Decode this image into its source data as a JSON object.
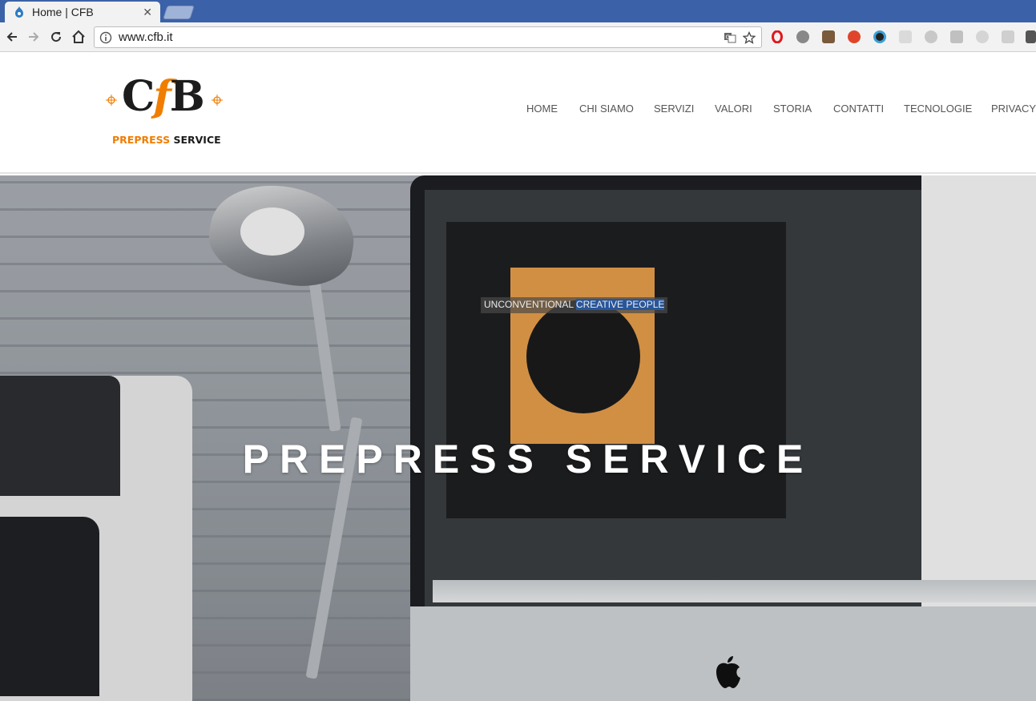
{
  "browser": {
    "tab_title": "Home | CFB",
    "url": "www.cfb.it"
  },
  "site": {
    "logo_mark": "CfB",
    "logo_sub_orange": "PREPRESS",
    "logo_sub_dark": "SERVICE",
    "nav": [
      "HOME",
      "CHI SIAMO",
      "SERVIZI",
      "VALORI",
      "STORIA",
      "CONTATTI",
      "TECNOLOGIE",
      "PRIVACY"
    ]
  },
  "hero": {
    "title": "PREPRESS SERVICE",
    "poster_text_a": "UNCONVENTIONAL",
    "poster_text_b": "CREATIVE PEOPLE"
  },
  "colors": {
    "tabstrip": "#3b62a8",
    "brand_orange": "#f07d00",
    "nav_text": "#555555"
  },
  "icons": {
    "back": "arrow-left-icon",
    "forward": "arrow-right-icon",
    "reload": "reload-icon",
    "home": "home-icon",
    "info": "info-icon",
    "translate": "translate-icon",
    "bookmark": "star-icon"
  }
}
